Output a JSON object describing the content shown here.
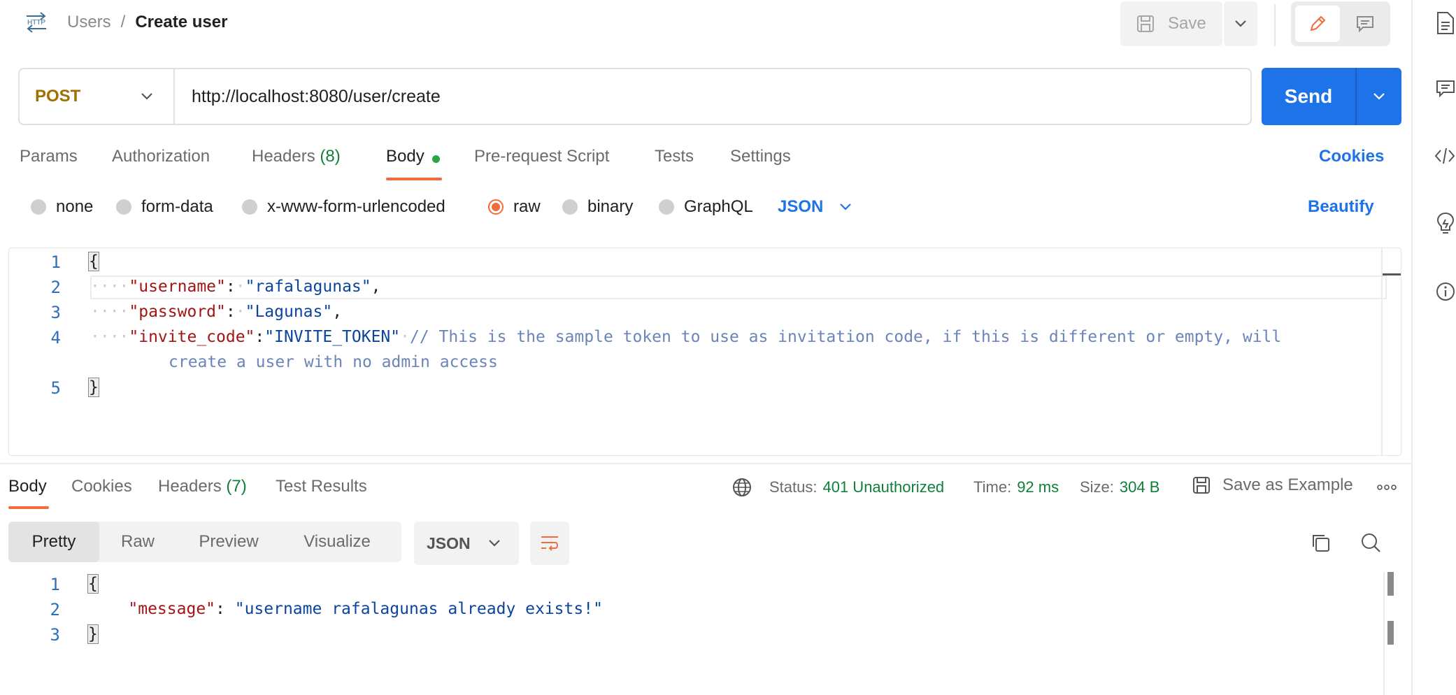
{
  "header": {
    "http_badge": "HTTP",
    "breadcrumb_parent": "Users",
    "breadcrumb_sep": "/",
    "title": "Create user",
    "save_label": "Save"
  },
  "request": {
    "method": "POST",
    "url": "http://localhost:8080/user/create",
    "send_label": "Send"
  },
  "tabs": {
    "params": "Params",
    "authorization": "Authorization",
    "headers": "Headers",
    "headers_count": "(8)",
    "body": "Body",
    "prerequest": "Pre-request Script",
    "tests": "Tests",
    "settings": "Settings",
    "cookies": "Cookies"
  },
  "body_types": {
    "none": "none",
    "form_data": "form-data",
    "urlencoded": "x-www-form-urlencoded",
    "raw": "raw",
    "binary": "binary",
    "graphql": "GraphQL",
    "format": "JSON",
    "beautify": "Beautify"
  },
  "request_body": {
    "line_numbers": [
      "1",
      "2",
      "3",
      "4",
      "5"
    ],
    "open_brace": "{",
    "close_brace": "}",
    "username_key": "\"username\"",
    "username_val": "\"rafalagunas\"",
    "password_key": "\"password\"",
    "password_val": "\"Lagunas\"",
    "invite_key": "\"invite_code\"",
    "invite_val": "\"INVITE_TOKEN\"",
    "comment_line1": "// This is the sample token to use as invitation code, if this is different or empty, will",
    "comment_line2": "create a user with no admin access"
  },
  "response": {
    "tab_body": "Body",
    "tab_cookies": "Cookies",
    "tab_headers": "Headers",
    "headers_count": "(7)",
    "tab_tests": "Test Results",
    "status_label": "Status:",
    "status_value": "401 Unauthorized",
    "time_label": "Time:",
    "time_value": "92 ms",
    "size_label": "Size:",
    "size_value": "304 B",
    "save_example": "Save as Example",
    "view_pretty": "Pretty",
    "view_raw": "Raw",
    "view_preview": "Preview",
    "view_visualize": "Visualize",
    "format": "JSON",
    "line_numbers": [
      "1",
      "2",
      "3"
    ],
    "open_brace": "{",
    "close_brace": "}",
    "message_key": "\"message\"",
    "message_val": "\"username rafalagunas already exists!\""
  },
  "colors": {
    "accent_orange": "#f26b3a",
    "send_blue": "#1f73e8",
    "status_green": "#0f7f3a"
  },
  "icons": [
    "http-icon",
    "save-icon",
    "chevron-down-icon",
    "pencil-icon",
    "comment-icon",
    "document-icon",
    "code-icon",
    "lightbulb-icon",
    "info-icon",
    "globe-icon",
    "copy-icon",
    "search-icon",
    "wrap-lines-icon",
    "more-icon"
  ]
}
